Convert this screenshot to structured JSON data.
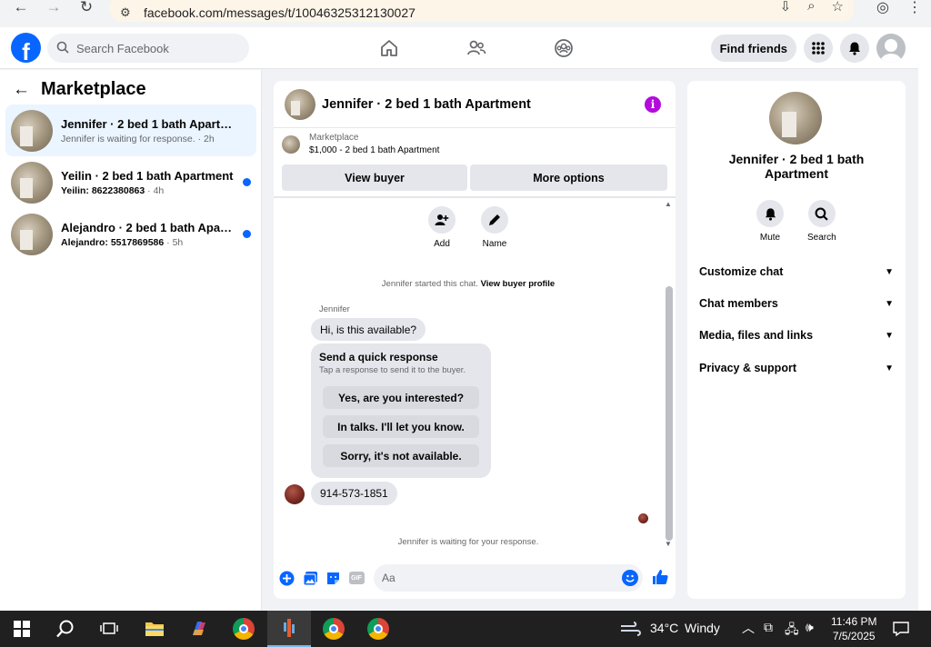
{
  "browser": {
    "url": "facebook.com/messages/t/10046325312130027"
  },
  "header": {
    "logo": "f",
    "search_placeholder": "Search Facebook",
    "find_friends": "Find friends"
  },
  "left": {
    "title": "Marketplace",
    "conversations": [
      {
        "name": "Jennifer · 2 bed 1 bath Apartment",
        "preview": "Jennifer is waiting for response. · 2h",
        "time": "",
        "active": true,
        "unread": false
      },
      {
        "name": "Yeilin · 2 bed 1 bath Apartment",
        "preview": "Yeilin: 8622380863",
        "time": " · 4h",
        "active": false,
        "unread": true
      },
      {
        "name": "Alejandro · 2 bed 1 bath Apartm...",
        "preview": "Alejandro: 5517869586",
        "time": " · 5h",
        "active": false,
        "unread": true
      }
    ]
  },
  "chat": {
    "title": "Jennifer · 2 bed 1 bath Apartment",
    "marketplace_label": "Marketplace",
    "listing": "$1,000 - 2 bed 1 bath Apartment",
    "view_buyer": "View buyer",
    "more_options": "More options",
    "add_label": "Add",
    "name_label": "Name",
    "started_text": "Jennifer started this chat.",
    "view_buyer_profile": "View buyer profile",
    "sender_name": "Jennifer",
    "message1": "Hi, is this available?",
    "quick_title": "Send a quick response",
    "quick_sub": "Tap a response to send it to the buyer.",
    "quick_replies": [
      "Yes, are you interested?",
      "In talks. I'll let you know.",
      "Sorry, it's not available."
    ],
    "message2": "914-573-1851",
    "waiting": "Jennifer is waiting for your response.",
    "composer_placeholder": "Aa",
    "gif_label": "GIF"
  },
  "right": {
    "name": "Jennifer · 2 bed 1 bath Apartment",
    "mute": "Mute",
    "search": "Search",
    "sections": [
      "Customize chat",
      "Chat members",
      "Media, files and links",
      "Privacy & support"
    ]
  },
  "taskbar": {
    "temperature": "34°C",
    "weather": "Windy",
    "time": "11:46 PM",
    "date": "7/5/2025"
  },
  "colors": {
    "accent": "#0866ff",
    "info": "#b30bdc"
  }
}
